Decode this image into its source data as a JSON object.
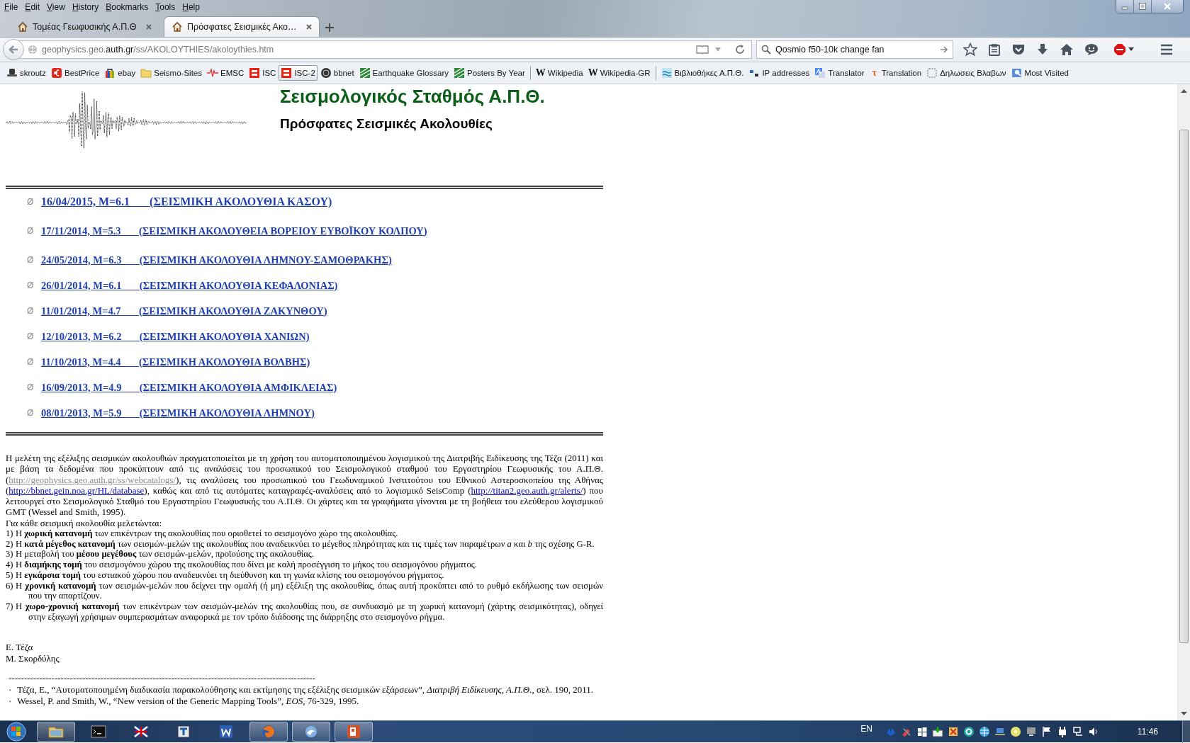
{
  "menu": [
    "File",
    "Edit",
    "View",
    "History",
    "Bookmarks",
    "Tools",
    "Help"
  ],
  "tabs": [
    {
      "title": "Τομέας Γεωφυσικής Α.Π.Θ",
      "selected": false
    },
    {
      "title": "Πρόσφατες Σεισμικές Ακο…",
      "selected": true
    }
  ],
  "address": {
    "prefix": "geophysics.geo.",
    "domain": "auth.gr",
    "path": "/ss/AKOLOYTHIES/akoloythies.htm"
  },
  "search": {
    "value": "Qosmio f50-10k change fan"
  },
  "bookmarks": [
    {
      "kind": "bookmark",
      "label": "skroutz",
      "hovered": false
    },
    {
      "kind": "bookmark",
      "label": "BestPrice",
      "hovered": false
    },
    {
      "kind": "bookmark",
      "label": "ebay",
      "hovered": false
    },
    {
      "kind": "bookmark",
      "label": "Seismo-Sites",
      "hovered": false
    },
    {
      "kind": "bookmark",
      "label": "EMSC",
      "hovered": false
    },
    {
      "kind": "bookmark",
      "label": "ISC",
      "hovered": false
    },
    {
      "kind": "bookmark",
      "label": "ISC-2",
      "hovered": true
    },
    {
      "kind": "bookmark",
      "label": "bbnet",
      "hovered": false
    },
    {
      "kind": "bookmark",
      "label": "Earthquake Glossary",
      "hovered": false
    },
    {
      "kind": "bookmark",
      "label": "Posters By Year",
      "hovered": false
    },
    {
      "kind": "separator"
    },
    {
      "kind": "bookmark",
      "glyph": "W",
      "label": "Wikipedia",
      "hovered": false
    },
    {
      "kind": "bookmark",
      "glyph": "W",
      "label": "Wikipedia-GR",
      "hovered": false
    },
    {
      "kind": "separator"
    },
    {
      "kind": "bookmark",
      "label": "Βιβλιοθήκες Α.Π.Θ.",
      "hovered": false
    },
    {
      "kind": "bookmark",
      "label": "IP addresses",
      "hovered": false
    },
    {
      "kind": "bookmark",
      "label": "Translator",
      "hovered": false
    },
    {
      "kind": "bookmark",
      "glyph": "τ",
      "label": "Translation",
      "hovered": false
    },
    {
      "kind": "bookmark",
      "label": "Δηλωσεις Βλαβων",
      "hovered": false
    },
    {
      "kind": "bookmark",
      "label": "Most Visited",
      "hovered": false
    }
  ],
  "page": {
    "station_title": "Σεισμολογικός Σταθμός Α.Π.Θ.",
    "page_title": "Πρόσφατες Σεισμικές Ακολουθίες",
    "sequences": [
      {
        "bullet": "Ø",
        "label": "16/04/2015, M=6.1       (ΣΕΙΣΜΙΚΗ ΑΚΟΛΟΥΘΙΑ ΚΑΣΟΥ)",
        "large": true
      },
      {
        "bullet": "Ø",
        "label": "17/11/2014, M=5.3       (ΣΕΙΣΜΙΚΗ ΑΚΟΛΟΥΘΕΙΑ ΒΟΡΕΙΟΥ ΕΥΒΟΪΚΟΥ ΚΟΛΠΟΥ)",
        "large": false
      },
      {
        "bullet": "Ø",
        "label": "24/05/2014, M=6.3       (ΣΕΙΣΜΙΚΗ ΑΚΟΛΟΥΘΙΑ ΛΗΜΝΟΥ-ΣΑΜΟΘΡΑΚΗΣ)",
        "large": false
      },
      {
        "bullet": "Ø",
        "label": "26/01/2014, M=6.1       (ΣΕΙΣΜΙΚΗ ΑΚΟΛΟΥΘΙΑ ΚΕΦΑΛΟΝΙΑΣ)",
        "large": false
      },
      {
        "bullet": "Ø",
        "label": "11/01/2014, M=4.7       (ΣΕΙΣΜΙΚΗ ΑΚΟΛΟΥΘΙΑ ΖΑΚΥΝΘΟΥ)",
        "large": false
      },
      {
        "bullet": "Ø",
        "label": "12/10/2013, M=6.2       (ΣΕΙΣΜΙΚΗ ΑΚΟΛΟΥΘΙΑ ΧΑΝΙΩΝ)",
        "large": false
      },
      {
        "bullet": "Ø",
        "label": "11/10/2013, M=4.4       (ΣΕΙΣΜΙΚΗ ΑΚΟΛΟΥΘΙΑ ΒΟΛΒΗΣ)",
        "large": false
      },
      {
        "bullet": "Ø",
        "label": "16/09/2013, M=4.9       (ΣΕΙΣΜΙΚΗ ΑΚΟΛΟΥΘΙΑ ΑΜΦΙΚΛΕΙΑΣ)",
        "large": false
      },
      {
        "bullet": "Ø",
        "label": "08/01/2013, M=5.9       (ΣΕΙΣΜΙΚΗ ΑΚΟΛΟΥΘΙΑ ΛΗΜΝΟΥ)",
        "large": false
      }
    ],
    "intro": [
      {
        "kind": "text",
        "text": "Η μελέτη της εξέλιξης σεισμικών ακολουθιών πραγματοποιείται με τη χρήση του αυτοματοποιημένου λογισμικού της Διατριβής Ειδίκευσης της Τέζα (2011) και με βάση τα δεδομένα που προκύπτουν από τις αναλύσεις του προσωπικού του Σεισμολογικού σταθμού του Εργαστηρίου Γεωφυσικής του Α.Π.Θ. ("
      },
      {
        "kind": "muted-link",
        "text": "http://geophysics.geo.auth.gr/ss/webcatalogs/"
      },
      {
        "kind": "text",
        "text": "), τις αναλύσεις του προσωπικού του Γεωδυναμικού Ινστιτούτου του Εθνικού Αστεροσκοπείου της Αθήνας ("
      },
      {
        "kind": "link",
        "text": "http://bbnet.gein.noa.gr/HL/database"
      },
      {
        "kind": "text",
        "text": "), καθώς και από τις αυτόματες καταγραφές-αναλύσεις από το λογισμικό SeisComp ("
      },
      {
        "kind": "link",
        "text": "http://titan2.geo.auth.gr/alerts/"
      },
      {
        "kind": "text",
        "text": ") που λειτουργεί στο Σεισμολογικό Σταθμό του Εργαστηρίου Γεωφυσικής του Α.Π.Θ. Οι χάρτες και τα γραφήματα γίνονται με τη βοήθεια του ελεύθερου λογισμικού GMT (Wessel and Smith, 1995)."
      }
    ],
    "studies_heading": "Για κάθε σεισμική ακολουθία μελετώνται:",
    "studies": [
      {
        "number": "1)",
        "text": "Η **χωρική κατανομή** των επικέντρων της ακολουθίας που οριοθετεί το  σεισμογόνο χώρο της ακολουθίας."
      },
      {
        "number": "2)",
        "text": "Η **κατά μέγεθος κατανομή** των σεισμών-μελών της ακολουθίας που αναδεικνύει το μέγεθος πληρότητας και τις τιμές των παραμέτρων *a* και *b* της σχέσης G-R."
      },
      {
        "number": "3)",
        "text": "Η μεταβολή του **μέσου μεγέθους** των σεισμών-μελών, προϊούσης της ακολουθίας."
      },
      {
        "number": "4)",
        "text": "Η **διαμήκης τομή** του σεισμογόνου χώρου της ακολουθίας που δίνει με καλή προσέγγιση το μήκος του σεισμογόνου ρήγματος."
      },
      {
        "number": "5)",
        "text": "Η **εγκάρσια τομή** του εστιακού χώρου που αναδεικνύει τη διεύθυνση και τη γωνία κλίσης του σεισμογόνου ρήγματος."
      },
      {
        "number": "6)",
        "text": "Η **χρονική κατανομή** των σεισμών-μελών που δείχνει την ομαλή (ή μη) εξέλιξη της ακολουθίας, όπως αυτή προκύπτει από το ρυθμό εκδήλωσης των σεισμών που την απαρτίζουν."
      },
      {
        "number": "7)",
        "text": "Η **χωρο-χρονική κατανομή** των επικέντρων των σεισμών-μελών της ακολουθίας που, σε συνδυασμό με τη χωρική κατανομή (χάρτης σεισμικότητας), οδηγεί στην εξαγωγή χρήσιμων συμπερασμάτων αναφορικά με τον τρόπο διάδοσης της διάρρηξης στο σεισμογόνο ρήγμα."
      }
    ],
    "authors": [
      "Ε. Τέζα",
      "Μ. Σκορδύλης"
    ],
    "references_rule": "----------------------------------------------------------------------------------------------------",
    "references": [
      {
        "bullet": "·",
        "text": "Τέζα, Ε., “Αυτοματοποιημένη διαδικασία παρακολούθησης και εκτίμησης της εξέλιξης σεισμικών εξάρσεων”, *Διατριβή Ειδίκευσης, Α.Π.Θ.*, σελ. 190, 2011."
      },
      {
        "bullet": "·",
        "text": "Wessel, P. and Smith, W., “New version of the Generic Mapping Tools”, *EOS*, 76-329, 1995."
      }
    ]
  },
  "taskbar": {
    "apps": [
      {
        "running": true
      },
      {
        "running": false
      },
      {
        "running": false
      },
      {
        "running": false
      },
      {
        "running": false
      },
      {
        "running": true
      },
      {
        "running": true
      },
      {
        "running": true
      }
    ],
    "language": "EN",
    "clock": "11:46"
  }
}
